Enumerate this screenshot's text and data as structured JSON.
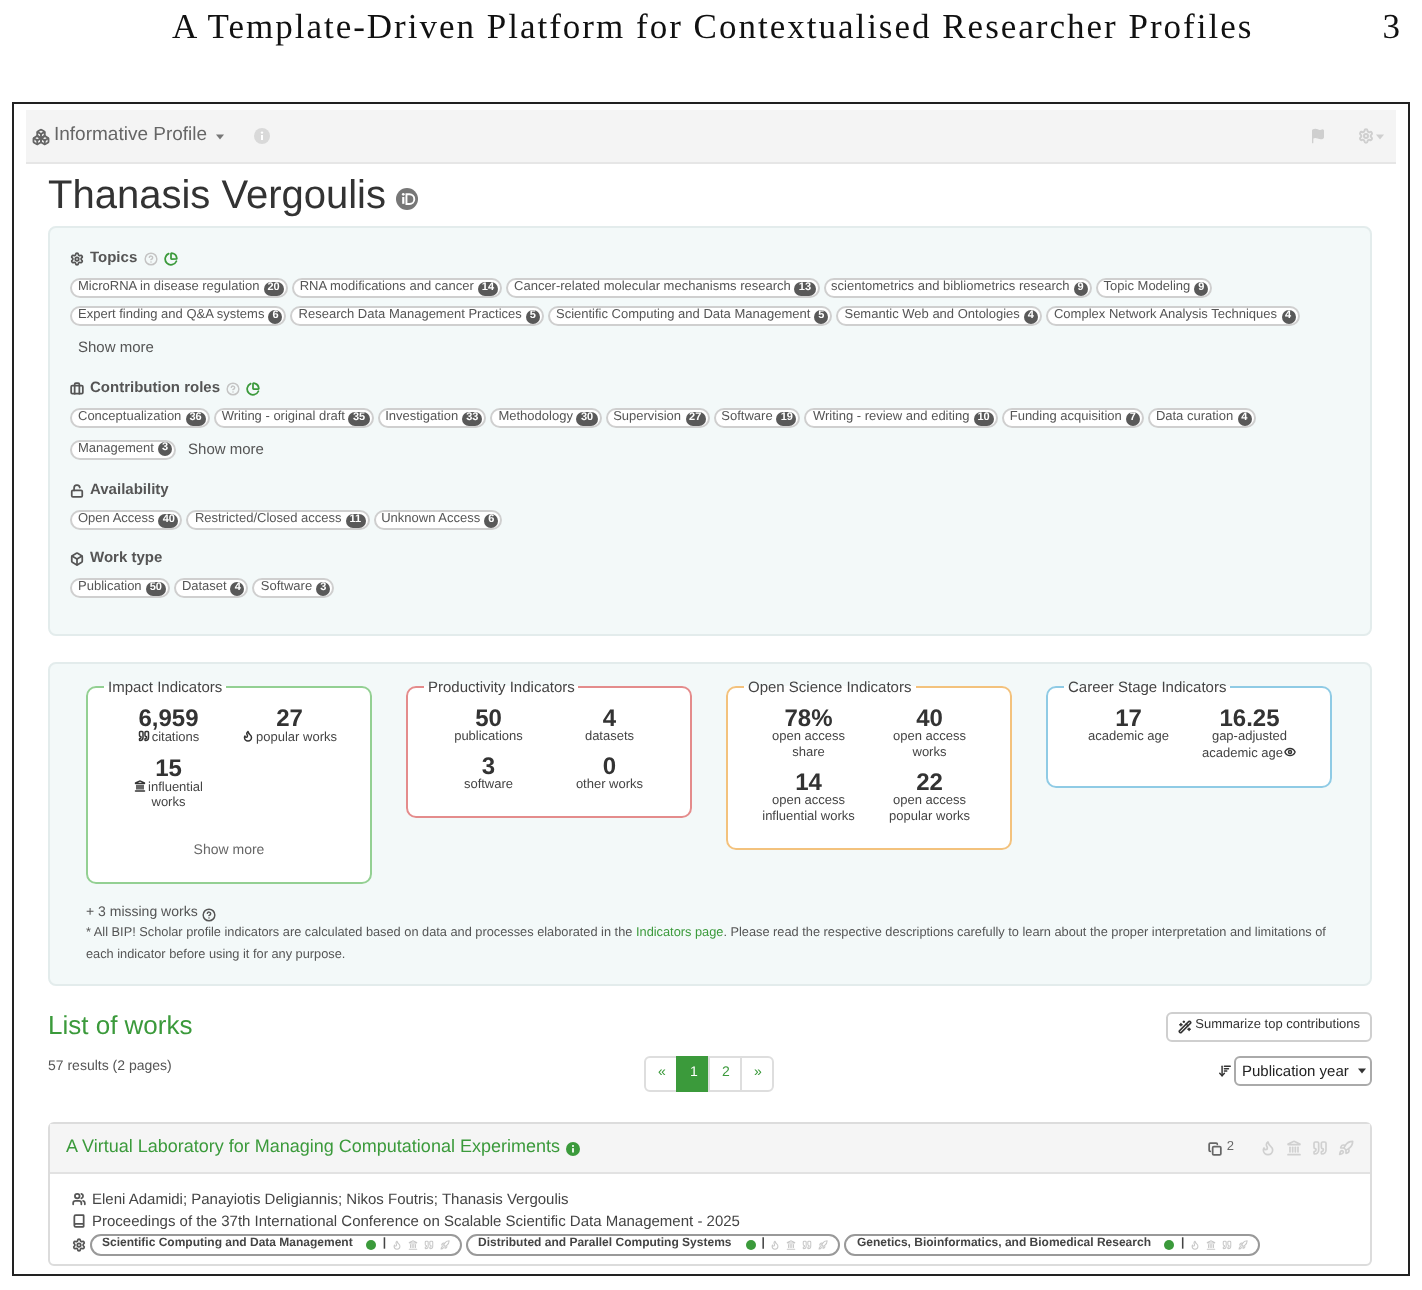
{
  "paper_header": {
    "title": "A Template-Driven Platform for Contextualised Researcher Profiles",
    "page_number": "3"
  },
  "toolbar": {
    "profile_menu": "Informative Profile"
  },
  "profile": {
    "name": "Thanasis Vergoulis"
  },
  "facets": [
    {
      "kind": "topics",
      "title": "Topics",
      "chips": [
        {
          "label": "MicroRNA in disease regulation",
          "count": "20"
        },
        {
          "label": "RNA modifications and cancer",
          "count": "14"
        },
        {
          "label": "Cancer-related molecular mechanisms research",
          "count": "13"
        },
        {
          "label": "scientometrics and bibliometrics research",
          "count": "9"
        },
        {
          "label": "Topic Modeling",
          "count": "9"
        },
        {
          "label": "Expert finding and Q&A systems",
          "count": "6"
        },
        {
          "label": "Research Data Management Practices",
          "count": "5"
        },
        {
          "label": "Scientific Computing and Data Management",
          "count": "5"
        },
        {
          "label": "Semantic Web and Ontologies",
          "count": "4"
        },
        {
          "label": "Complex Network Analysis Techniques",
          "count": "4"
        }
      ],
      "show_more": "Show more"
    },
    {
      "kind": "roles",
      "title": "Contribution roles",
      "chips": [
        {
          "label": "Conceptualization",
          "count": "36"
        },
        {
          "label": "Writing - original draft",
          "count": "35"
        },
        {
          "label": "Investigation",
          "count": "33"
        },
        {
          "label": "Methodology",
          "count": "30"
        },
        {
          "label": "Supervision",
          "count": "27"
        },
        {
          "label": "Software",
          "count": "19"
        },
        {
          "label": "Writing - review and editing",
          "count": "10"
        },
        {
          "label": "Funding acquisition",
          "count": "7"
        },
        {
          "label": "Data curation",
          "count": "4"
        },
        {
          "label": "Management",
          "count": "3"
        }
      ],
      "show_more": "Show more"
    },
    {
      "kind": "availability",
      "title": "Availability",
      "chips": [
        {
          "label": "Open Access",
          "count": "40"
        },
        {
          "label": "Restricted/Closed access",
          "count": "11"
        },
        {
          "label": "Unknown Access",
          "count": "6"
        }
      ]
    },
    {
      "kind": "worktype",
      "title": "Work type",
      "chips": [
        {
          "label": "Publication",
          "count": "50"
        },
        {
          "label": "Dataset",
          "count": "4"
        },
        {
          "label": "Software",
          "count": "3"
        }
      ]
    }
  ],
  "indicators": [
    {
      "title": "Impact Indicators",
      "color": "#93d093",
      "metrics": [
        {
          "kind": "citations",
          "value": "6,959",
          "label": "citations"
        },
        {
          "kind": "popularity",
          "value": "27",
          "label": "popular works"
        },
        {
          "kind": "influence",
          "value": "15",
          "label": "influential works"
        }
      ],
      "show_more": "Show more"
    },
    {
      "title": "Productivity Indicators",
      "color": "#e48c8c",
      "metrics": [
        {
          "kind": "plain",
          "value": "50",
          "label": "publications"
        },
        {
          "kind": "plain",
          "value": "4",
          "label": "datasets"
        },
        {
          "kind": "plain",
          "value": "3",
          "label": "software"
        },
        {
          "kind": "plain",
          "value": "0",
          "label": "other works"
        }
      ]
    },
    {
      "title": "Open Science Indicators",
      "color": "#f3c27d",
      "metrics": [
        {
          "kind": "plain",
          "value": "78%",
          "label": "open access share"
        },
        {
          "kind": "plain",
          "value": "40",
          "label": "open access works"
        },
        {
          "kind": "plain",
          "value": "14",
          "label": "open access influential works"
        },
        {
          "kind": "plain",
          "value": "22",
          "label": "open access popular works"
        }
      ]
    },
    {
      "title": "Career Stage Indicators",
      "color": "#8fcbe5",
      "metrics": [
        {
          "kind": "plain",
          "value": "17",
          "label": "academic age"
        },
        {
          "kind": "adjusted",
          "value": "16.25",
          "label": "gap-adjusted academic age"
        }
      ]
    }
  ],
  "notes": {
    "missing_works": "+ 3 missing works",
    "disclaimer_before": "* All BIP! Scholar profile indicators are calculated based on data and processes elaborated in the",
    "disclaimer_link": "Indicators page",
    "disclaimer_after": ". Please read the respective descriptions carefully to learn about the proper interpretation and limitations of each indicator before using it for any purpose."
  },
  "works_list": {
    "heading": "List of works",
    "summary_button": "Summarize top contributions",
    "results": "57 results (2 pages)",
    "pagination": [
      {
        "label": "«",
        "selected": false
      },
      {
        "label": "1",
        "selected": true
      },
      {
        "label": "2",
        "selected": false
      },
      {
        "label": "»",
        "selected": false
      }
    ],
    "sort": "Publication year"
  },
  "works": [
    {
      "title": "A Virtual Laboratory for Managing Computational Experiments",
      "versions": "2",
      "authors": "Eleni Adamidi; Panayiotis Deligiannis; Nikos Foutris; Thanasis Vergoulis",
      "venue": "Proceedings of the 37th International Conference on Scalable Scientific Data Management - 2025",
      "topics": [
        {
          "label": "Scientific Computing and Data Management",
          "separator": "|"
        },
        {
          "label": "Distributed and Parallel Computing Systems",
          "separator": "|"
        },
        {
          "label": "Genetics, Bioinformatics, and Biomedical Research",
          "separator": "|"
        }
      ]
    }
  ]
}
